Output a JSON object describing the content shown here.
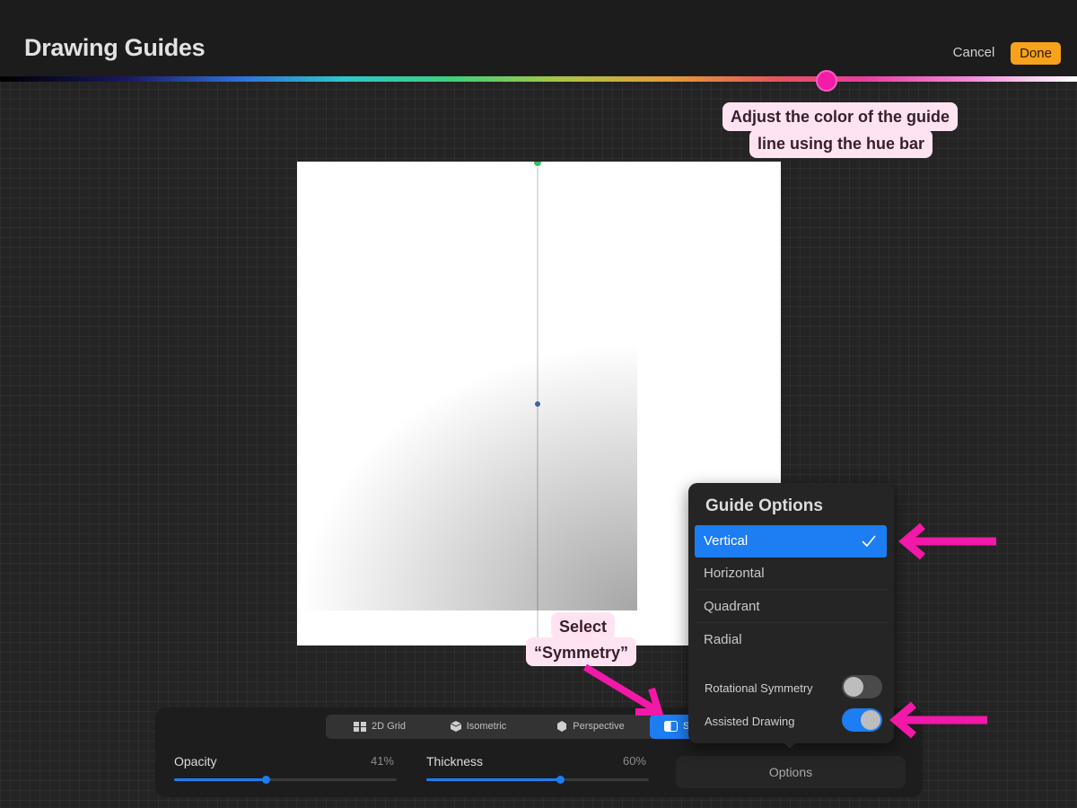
{
  "header": {
    "title": "Drawing Guides",
    "cancel_label": "Cancel",
    "done_label": "Done"
  },
  "hue_bar": {
    "knob_color": "#f21ca6"
  },
  "annotations": {
    "hue_callout_line1": "Adjust the color of the guide",
    "hue_callout_line2": "line using the hue bar",
    "symmetry_callout_line1": "Select",
    "symmetry_callout_line2": "“Symmetry”",
    "arrow_color": "#f218a8"
  },
  "guide_types": [
    {
      "label": "2D Grid",
      "icon": "grid-icon"
    },
    {
      "label": "Isometric",
      "icon": "cube-icon"
    },
    {
      "label": "Perspective",
      "icon": "perspective-cube-icon"
    },
    {
      "label": "S",
      "icon": "symmetry-icon",
      "active": true
    }
  ],
  "sliders": {
    "opacity_label": "Opacity",
    "opacity_value": "41%",
    "opacity_fraction": 0.41,
    "thickness_label": "Thickness",
    "thickness_value": "60%",
    "thickness_fraction": 0.6
  },
  "options_button_label": "Options",
  "guide_options": {
    "title": "Guide Options",
    "items": [
      "Vertical",
      "Horizontal",
      "Quadrant",
      "Radial"
    ],
    "selected": "Vertical",
    "rotational_symmetry_label": "Rotational Symmetry",
    "rotational_symmetry_on": false,
    "assisted_drawing_label": "Assisted Drawing",
    "assisted_drawing_on": true
  },
  "colors": {
    "accent": "#1d7df2",
    "done_button": "#f7a21b"
  }
}
